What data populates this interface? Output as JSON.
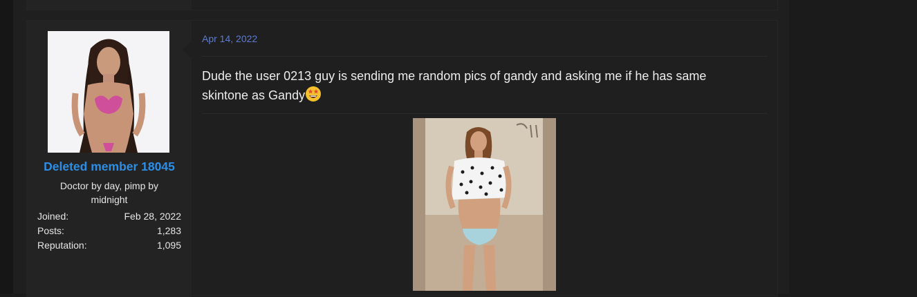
{
  "post": {
    "date": "Apr 14, 2022",
    "message": "Dude the user 0213 guy is sending me random pics of gandy and asking me if he has same skintone as Gandy"
  },
  "user": {
    "name": "Deleted member 18045",
    "title": "Doctor by day, pimp by midnight",
    "stats": [
      {
        "label": "Joined:",
        "value": "Feb 28, 2022"
      },
      {
        "label": "Posts:",
        "value": "1,283"
      },
      {
        "label": "Reputation:",
        "value": "1,095"
      }
    ]
  },
  "colors": {
    "username": "#2d8ee6",
    "date": "#5d7bd0",
    "page_bg": "#1f1f1f"
  },
  "icons": {
    "reaction_emoji": "grinning-star-struck-emoji"
  }
}
